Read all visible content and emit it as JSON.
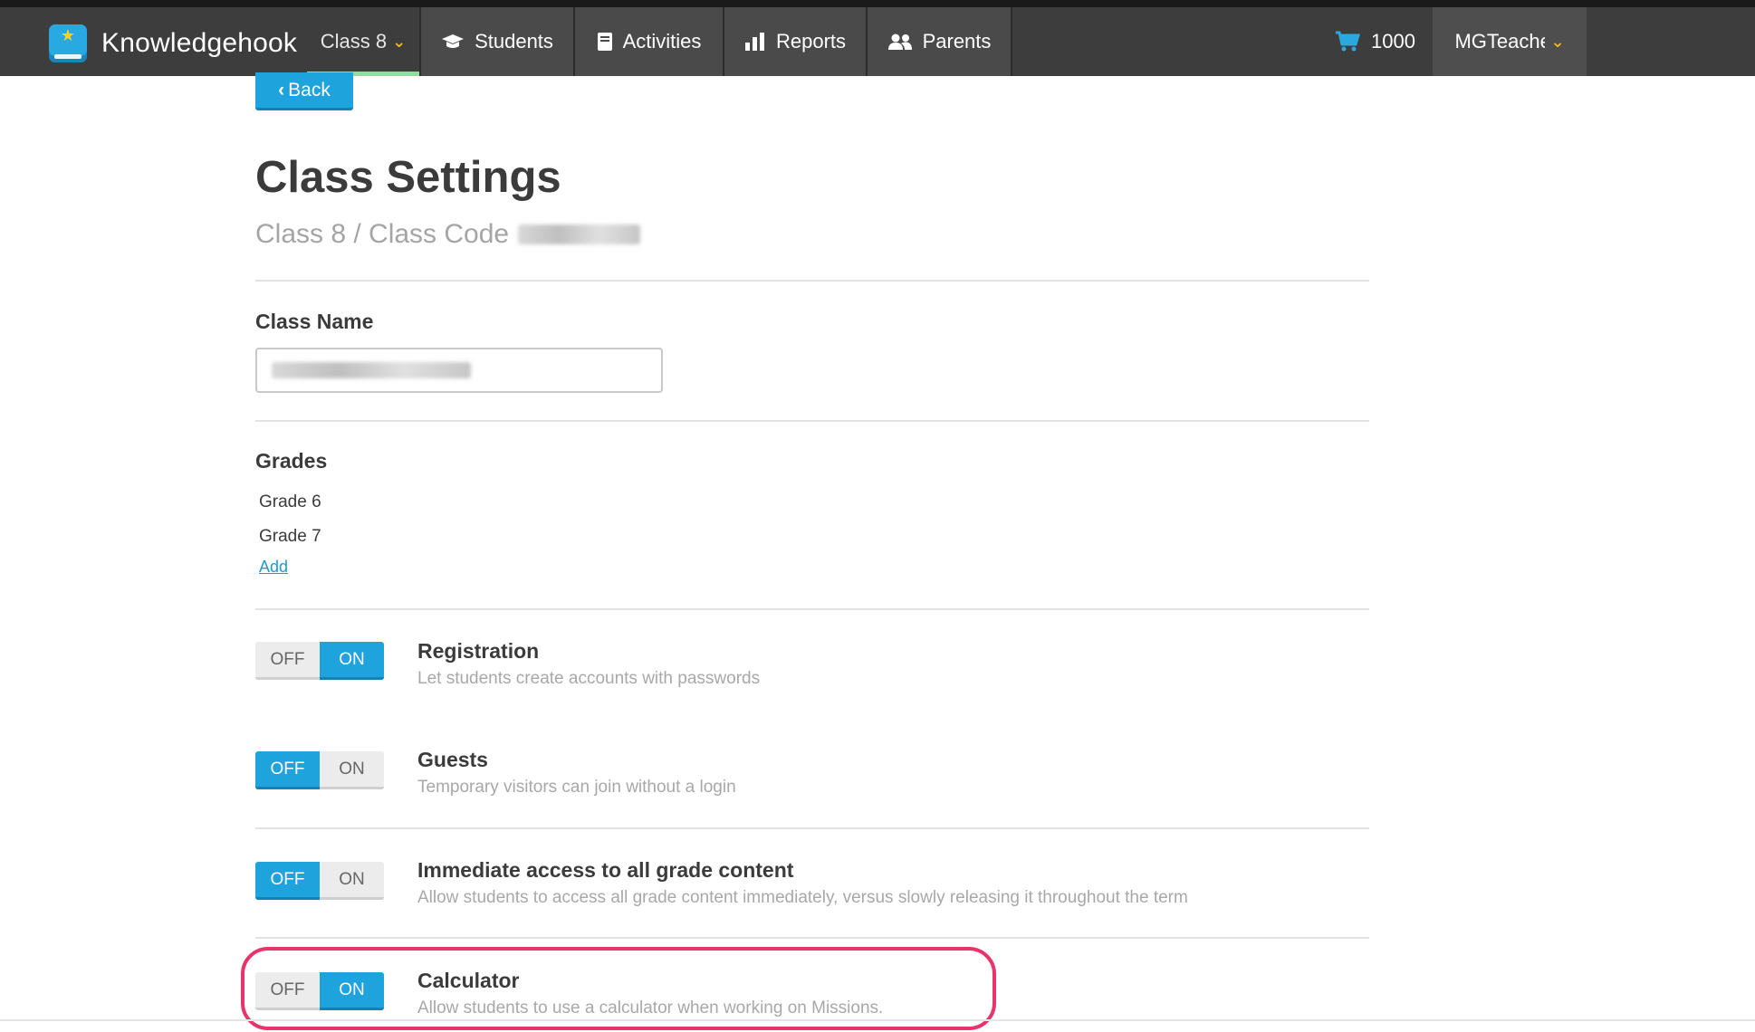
{
  "nav": {
    "brand": "Knowledgehook",
    "class_selector": "Class 8",
    "students": "Students",
    "activities": "Activities",
    "reports": "Reports",
    "parents": "Parents",
    "cart_count": "1000",
    "user": "MGTeacher"
  },
  "page": {
    "back": "Back",
    "title": "Class Settings",
    "subtitle": "Class 8 / Class Code",
    "class_name_label": "Class Name",
    "grades_label": "Grades",
    "grades": [
      "Grade 6",
      "Grade 7"
    ],
    "add_link": "Add"
  },
  "settings": [
    {
      "title": "Registration",
      "desc": "Let students create accounts with passwords",
      "off": "OFF",
      "on": "ON",
      "state": "on"
    },
    {
      "title": "Guests",
      "desc": "Temporary visitors can join without a login",
      "off": "OFF",
      "on": "ON",
      "state": "off"
    },
    {
      "title": "Immediate access to all grade content",
      "desc": "Allow students to access all grade content immediately, versus slowly releasing it throughout the term",
      "off": "OFF",
      "on": "ON",
      "state": "off"
    },
    {
      "title": "Calculator",
      "desc": "Allow students to use a calculator when working on Missions.",
      "off": "OFF",
      "on": "ON",
      "state": "on"
    }
  ],
  "colors": {
    "accent": "#1fa3dc",
    "nav_bg": "#3d3d3d",
    "highlight": "#e8336b",
    "chevron": "#f5b81c"
  }
}
